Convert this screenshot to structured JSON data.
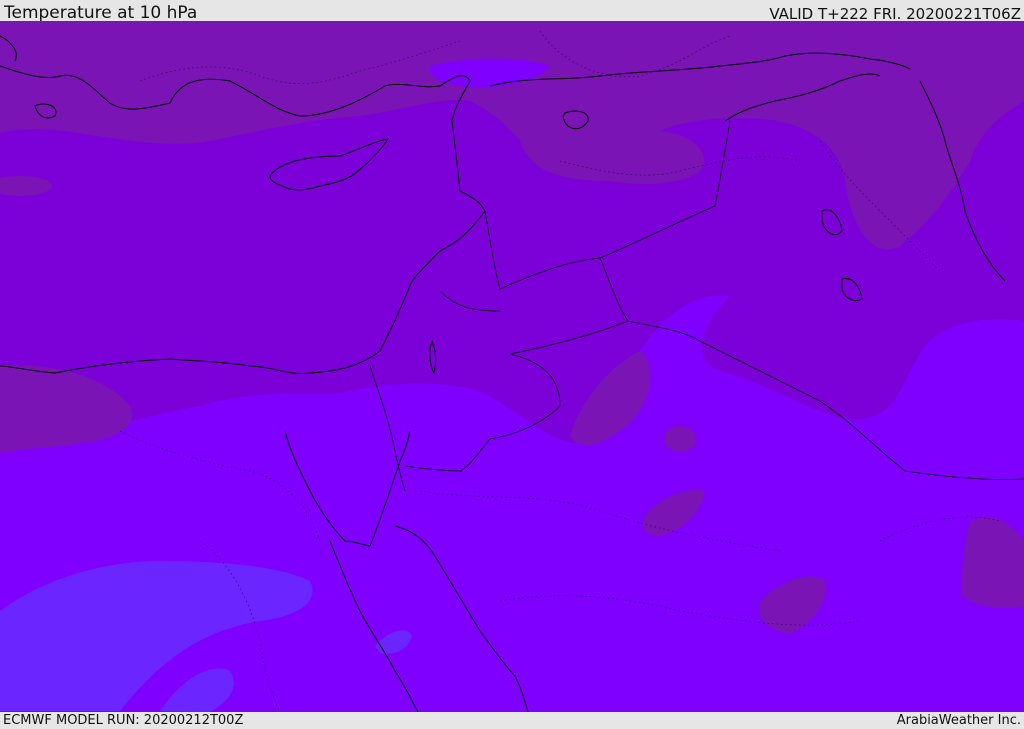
{
  "header": {
    "title": "Temperature at 10 hPa",
    "valid": "VALID T+222 FRI. 20200221T06Z"
  },
  "footer": {
    "model_run": "ECMWF MODEL RUN: 20200212T00Z",
    "credit": "ArabiaWeather Inc."
  },
  "map": {
    "field": "temperature",
    "level": "10 hPa",
    "colors": {
      "zone_cold": "#7a14b4",
      "zone_mid": "#7c00d8",
      "zone_warm": "#7f00ff",
      "zone_warmest": "#6b26ff",
      "coastline": "#000000",
      "border": "#000000"
    }
  }
}
